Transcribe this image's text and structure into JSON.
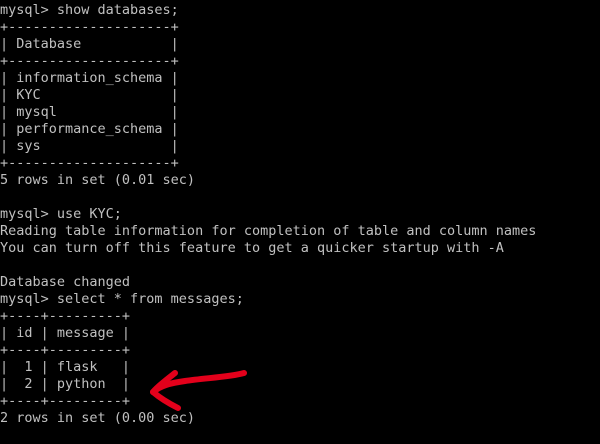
{
  "lines": [
    "mysql> show databases;",
    "+--------------------+",
    "| Database           |",
    "+--------------------+",
    "| information_schema |",
    "| KYC                |",
    "| mysql              |",
    "| performance_schema |",
    "| sys                |",
    "+--------------------+",
    "5 rows in set (0.01 sec)",
    "",
    "mysql> use KYC;",
    "Reading table information for completion of table and column names",
    "You can turn off this feature to get a quicker startup with -A",
    "",
    "Database changed",
    "mysql> select * from messages;",
    "+----+---------+",
    "| id | message |",
    "+----+---------+",
    "|  1 | flask   |",
    "|  2 | python  |",
    "+----+---------+",
    "2 rows in set (0.00 sec)"
  ],
  "colors": {
    "background": "#000000",
    "text": "#c0c0c0",
    "annotation_arrow": "#e3001b"
  },
  "annotation": {
    "icon": "red-arrow-icon"
  }
}
